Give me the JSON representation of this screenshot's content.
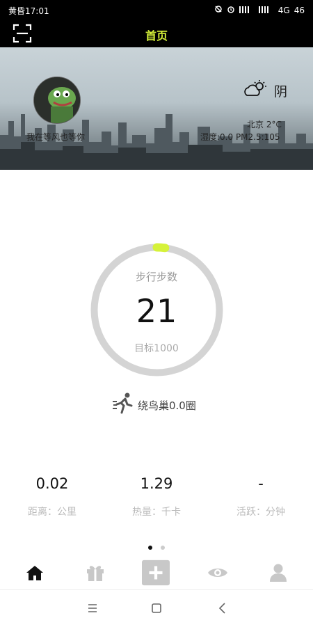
{
  "status_bar": {
    "time": "黄昏17:01",
    "network": "4G",
    "battery": "46"
  },
  "app_bar": {
    "title": "首页",
    "scan_icon": "scan-icon",
    "accent": "#d6f23a"
  },
  "profile": {
    "username": "我在等风也等你"
  },
  "weather": {
    "icon": "cloudy-sun-icon",
    "condition": "阴",
    "city_temp": "北京   2°C",
    "aqi_pm": "湿度:0.0   PM2.5:105"
  },
  "steps": {
    "label": "步行步数",
    "value": "21",
    "goal": "目标1000",
    "progress_fraction": 0.021
  },
  "laps": {
    "icon": "runner-icon",
    "text": "绕鸟巢0.0圈"
  },
  "stats": [
    {
      "value": "0.02",
      "label": "距离：公里"
    },
    {
      "value": "1.29",
      "label": "热量：千卡"
    },
    {
      "value": "-",
      "label": "活跃：分钟"
    }
  ],
  "pager": {
    "active_index": 0,
    "count": 2
  },
  "tab_bar": {
    "items": [
      {
        "name": "home",
        "icon": "home-icon",
        "active": true
      },
      {
        "name": "gift",
        "icon": "gift-icon",
        "active": false
      },
      {
        "name": "add",
        "icon": "plus-box-icon",
        "active": false
      },
      {
        "name": "watch",
        "icon": "eye-icon",
        "active": false
      },
      {
        "name": "profile",
        "icon": "user-icon",
        "active": false
      }
    ]
  },
  "system_nav": {
    "menu": "menu-icon",
    "home": "square-icon",
    "back": "back-chevron-icon"
  }
}
